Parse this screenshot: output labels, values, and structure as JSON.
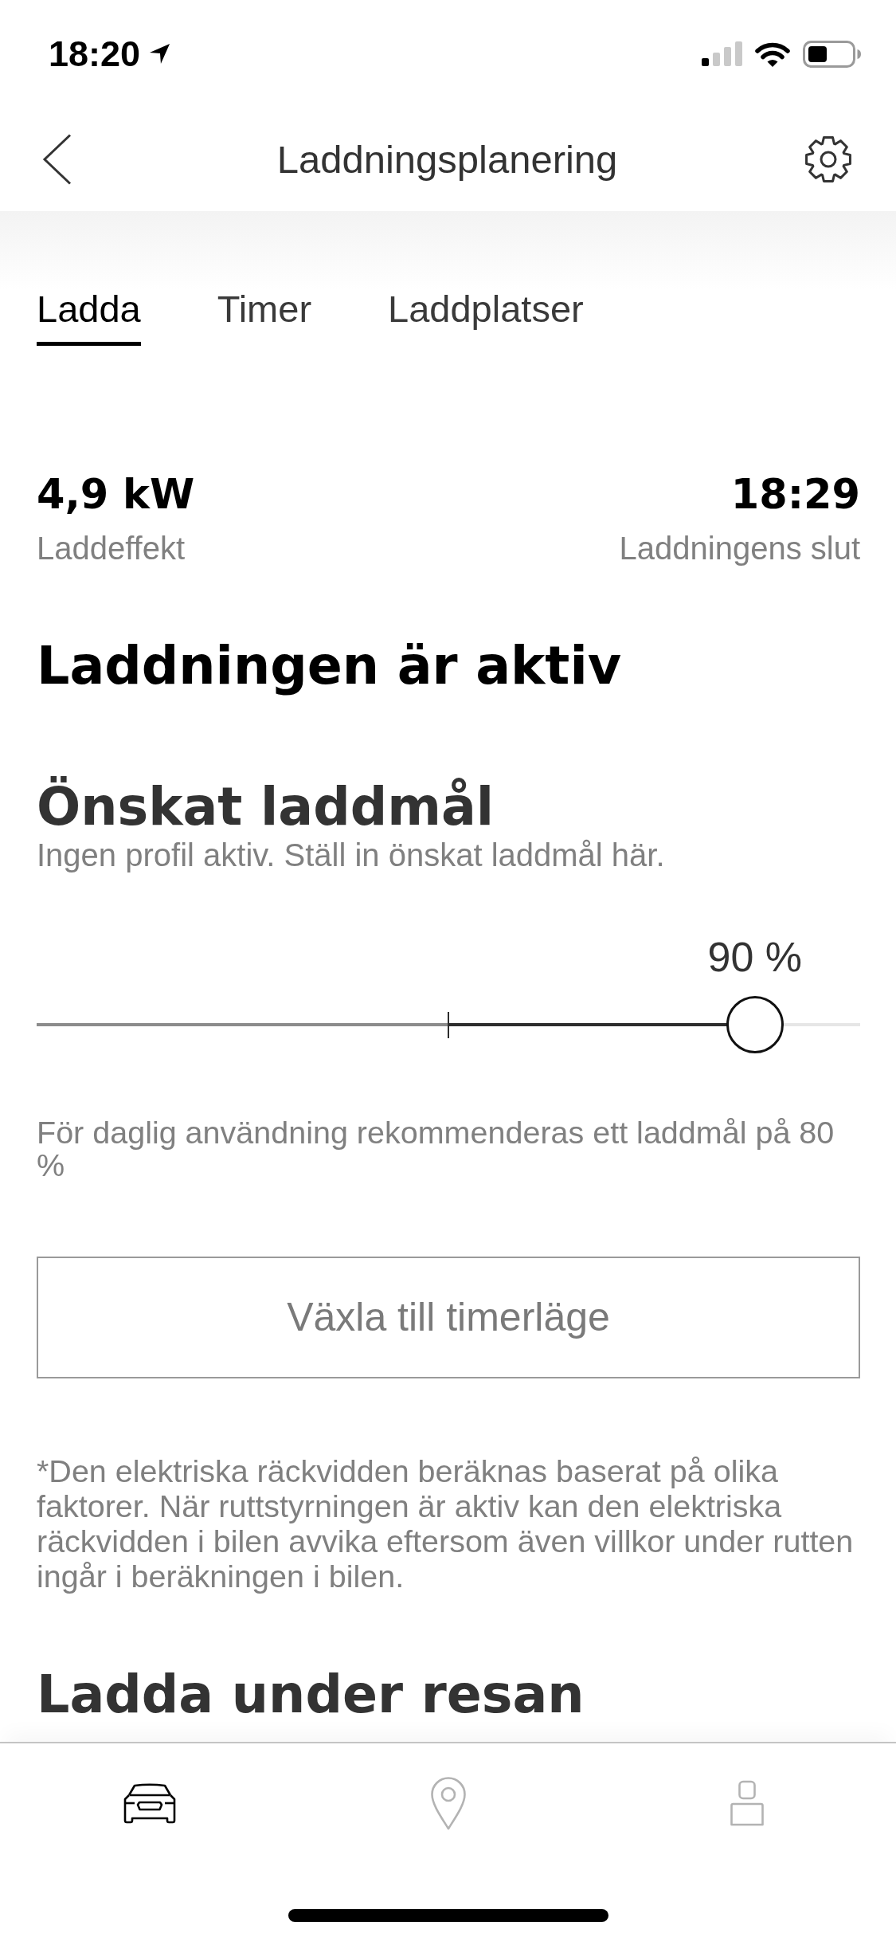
{
  "status_bar": {
    "time": "18:20"
  },
  "header": {
    "title": "Laddningsplanering"
  },
  "tabs": [
    {
      "label": "Ladda",
      "selected": true
    },
    {
      "label": "Timer",
      "selected": false
    },
    {
      "label": "Laddplatser",
      "selected": false
    }
  ],
  "stats": [
    {
      "value": "4,9 kW",
      "label": "Laddeffekt"
    },
    {
      "value": "18:29",
      "label": "Laddningens slut"
    }
  ],
  "status_heading": "Laddningen är aktiv",
  "charge_target": {
    "title": "Önskat laddmål",
    "subtitle": "Ingen profil aktiv. Ställ in önskat laddmål här.",
    "reading": "90 %",
    "level": 0.9,
    "tick": {
      "level": 0.5
    },
    "recommendation": "För daglig användning rekommenderas ett laddmål på 80 %"
  },
  "timer_button": "Växla till timerläge",
  "footnote": "*Den elektriska räckvidden beräknas baserat på olika faktorer. När ruttstyrningen är aktiv kan den elektriska räckvidden i bilen avvika eftersom även villkor under rutten ingår i beräkningen i bilen.",
  "next_section": {
    "title": "Ladda under resan"
  },
  "bottom_nav": [
    {
      "kind": "vehicle",
      "selected": true
    },
    {
      "kind": "map",
      "selected": false
    },
    {
      "kind": "profile",
      "selected": false
    }
  ]
}
